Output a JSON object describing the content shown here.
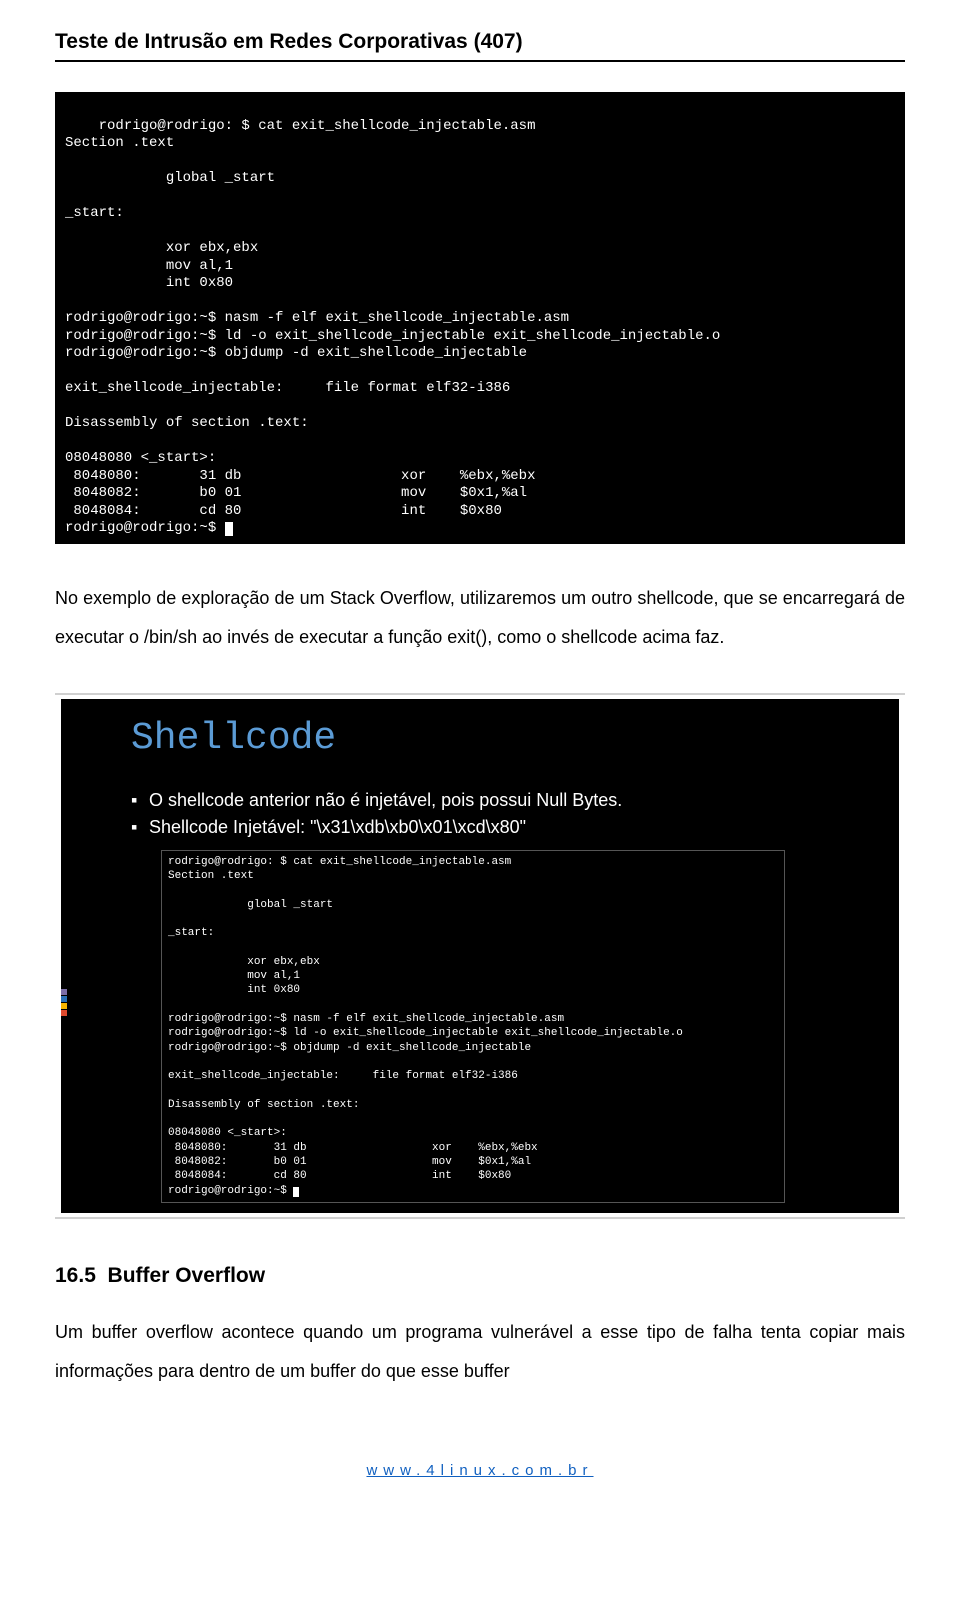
{
  "header": {
    "title": "Teste de Intrusão em Redes Corporativas (407)"
  },
  "terminal1": {
    "lines": [
      "rodrigo@rodrigo: $ cat exit_shellcode_injectable.asm",
      "Section .text",
      "",
      "            global _start",
      "",
      "_start:",
      "",
      "            xor ebx,ebx",
      "            mov al,1",
      "            int 0x80",
      "",
      "rodrigo@rodrigo:~$ nasm -f elf exit_shellcode_injectable.asm",
      "rodrigo@rodrigo:~$ ld -o exit_shellcode_injectable exit_shellcode_injectable.o",
      "rodrigo@rodrigo:~$ objdump -d exit_shellcode_injectable",
      "",
      "exit_shellcode_injectable:     file format elf32-i386",
      "",
      "Disassembly of section .text:",
      "",
      "08048080 <_start>:",
      " 8048080:       31 db                   xor    %ebx,%ebx",
      " 8048082:       b0 01                   mov    $0x1,%al",
      " 8048084:       cd 80                   int    $0x80"
    ],
    "prompt_end": "rodrigo@rodrigo:~$ "
  },
  "paragraph1": "No exemplo de exploração de um Stack Overflow, utilizaremos um outro shellcode, que se encarregará de executar o /bin/sh ao invés de executar a função exit(), como o shellcode acima faz.",
  "slide": {
    "title": "Shellcode",
    "bullets": [
      "O shellcode anterior não é injetável, pois possui Null Bytes.",
      "Shellcode Injetável: \"\\x31\\xdb\\xb0\\x01\\xcd\\x80\""
    ],
    "mini_terminal": {
      "lines": [
        "rodrigo@rodrigo: $ cat exit_shellcode_injectable.asm",
        "Section .text",
        "",
        "            global _start",
        "",
        "_start:",
        "",
        "            xor ebx,ebx",
        "            mov al,1",
        "            int 0x80",
        "",
        "rodrigo@rodrigo:~$ nasm -f elf exit_shellcode_injectable.asm",
        "rodrigo@rodrigo:~$ ld -o exit_shellcode_injectable exit_shellcode_injectable.o",
        "rodrigo@rodrigo:~$ objdump -d exit_shellcode_injectable",
        "",
        "exit_shellcode_injectable:     file format elf32-i386",
        "",
        "Disassembly of section .text:",
        "",
        "08048080 <_start>:",
        " 8048080:       31 db                   xor    %ebx,%ebx",
        " 8048082:       b0 01                   mov    $0x1,%al",
        " 8048084:       cd 80                   int    $0x80"
      ],
      "prompt_end": "rodrigo@rodrigo:~$ "
    },
    "accent_colors": [
      "#7c6ea8",
      "#2a6fb5",
      "#f7b500",
      "#de4a2e"
    ]
  },
  "section": {
    "number": "16.5",
    "title": "Buffer Overflow"
  },
  "paragraph2": "Um buffer overflow acontece quando um programa vulnerável a esse tipo de falha tenta copiar mais informações para dentro de um buffer do que esse buffer",
  "footer": "www.4linux.com.br"
}
